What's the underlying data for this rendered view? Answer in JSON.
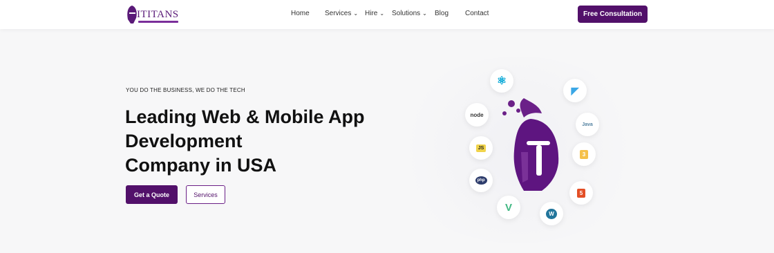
{
  "header": {
    "logo_text": "ITITANS",
    "nav": [
      {
        "label": "Home",
        "has_dropdown": false
      },
      {
        "label": "Services",
        "has_dropdown": true
      },
      {
        "label": "Hire",
        "has_dropdown": true
      },
      {
        "label": "Solutions",
        "has_dropdown": true
      },
      {
        "label": "Blog",
        "has_dropdown": false
      },
      {
        "label": "Contact",
        "has_dropdown": false
      }
    ],
    "cta_label": "Free Consultation"
  },
  "hero": {
    "eyebrow": "YOU DO THE BUSINESS, WE DO THE TECH",
    "headline_line1": "Leading Web & Mobile App",
    "headline_line2": "Development",
    "headline_line3": "Company in USA",
    "primary_button": "Get a Quote",
    "secondary_button": "Services"
  },
  "illustration": {
    "tech_badges": [
      {
        "name": "react-icon",
        "label": "⚛"
      },
      {
        "name": "flutter-icon",
        "label": "◤"
      },
      {
        "name": "node-icon",
        "label": "node"
      },
      {
        "name": "java-icon",
        "label": "Java"
      },
      {
        "name": "js-icon",
        "label": "JS"
      },
      {
        "name": "css-icon",
        "label": "3"
      },
      {
        "name": "php-icon",
        "label": "php"
      },
      {
        "name": "html5-icon",
        "label": "5"
      },
      {
        "name": "vue-icon",
        "label": "V"
      },
      {
        "name": "wordpress-icon",
        "label": "W"
      }
    ],
    "accent_color": "#52106a"
  }
}
